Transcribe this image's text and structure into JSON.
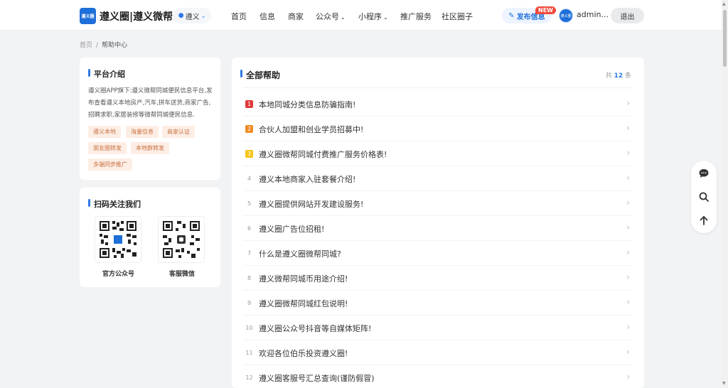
{
  "header": {
    "logo_text": "遵义圈",
    "site_title": "遵义圈|遵义微帮",
    "city": "遵义",
    "nav": [
      {
        "label": "首页",
        "dropdown": false
      },
      {
        "label": "信息",
        "dropdown": false
      },
      {
        "label": "商家",
        "dropdown": false
      },
      {
        "label": "公众号",
        "dropdown": true
      },
      {
        "label": "小程序",
        "dropdown": true
      },
      {
        "label": "推广服务",
        "dropdown": false
      },
      {
        "label": "社区圈子",
        "dropdown": false
      }
    ],
    "publish_label": "发布信息",
    "new_badge": "NEW",
    "avatar_text": "遵义圈",
    "username": "admin...",
    "logout_label": "退出"
  },
  "breadcrumb": {
    "home": "首页",
    "separator": "/",
    "current": "帮助中心"
  },
  "intro": {
    "title": "平台介绍",
    "text": "遵义圈APP旗下:遵义微帮同城便民信息平台,发布查看遵义本地房产,汽车,拼车送货,商家广告,招聘求职,家居装修等微帮同城便民信息.",
    "tags": [
      "遵义本地",
      "海量信息",
      "商家认证",
      "朋友圈转发",
      "本地群转发",
      "多端同步推广"
    ]
  },
  "follow": {
    "title": "扫码关注我们",
    "qr": [
      {
        "label": "官方公众号",
        "icon": "qr-code-icon"
      },
      {
        "label": "客服微信",
        "icon": "qr-code-icon"
      }
    ]
  },
  "help": {
    "title": "全部帮助",
    "count_prefix": "共",
    "count": "12",
    "count_suffix": "条",
    "items": [
      {
        "num": "1",
        "text": "本地同城分类信息防骗指南!"
      },
      {
        "num": "2",
        "text": "合伙人加盟和创业学员招募中!"
      },
      {
        "num": "3",
        "text": "遵义圈微帮同城付费推广服务价格表!"
      },
      {
        "num": "4",
        "text": "遵义本地商家入驻套餐介绍!"
      },
      {
        "num": "5",
        "text": "遵义圈提供网站开发建设服务!"
      },
      {
        "num": "6",
        "text": "遵义圈广告位招租!"
      },
      {
        "num": "7",
        "text": "什么是遵义圈微帮同城?"
      },
      {
        "num": "8",
        "text": "遵义微帮同城币用途介绍!"
      },
      {
        "num": "9",
        "text": "遵义圈微帮同城红包说明!"
      },
      {
        "num": "10",
        "text": "遵义圈公众号抖音等自媒体矩阵!"
      },
      {
        "num": "11",
        "text": "欢迎各位伯乐投资遵义圈!"
      },
      {
        "num": "12",
        "text": "遵义圈客服号汇总查询(谨防假冒)"
      }
    ]
  },
  "floatbar": {
    "icons": [
      "chat-icon",
      "search-icon",
      "back-to-top-icon"
    ]
  },
  "colors": {
    "accent": "#2f7ae5",
    "brand": "#1e6fd9",
    "badge": "#f04a3c",
    "tag_bg": "#fdeee5",
    "tag_text": "#c8703f"
  }
}
